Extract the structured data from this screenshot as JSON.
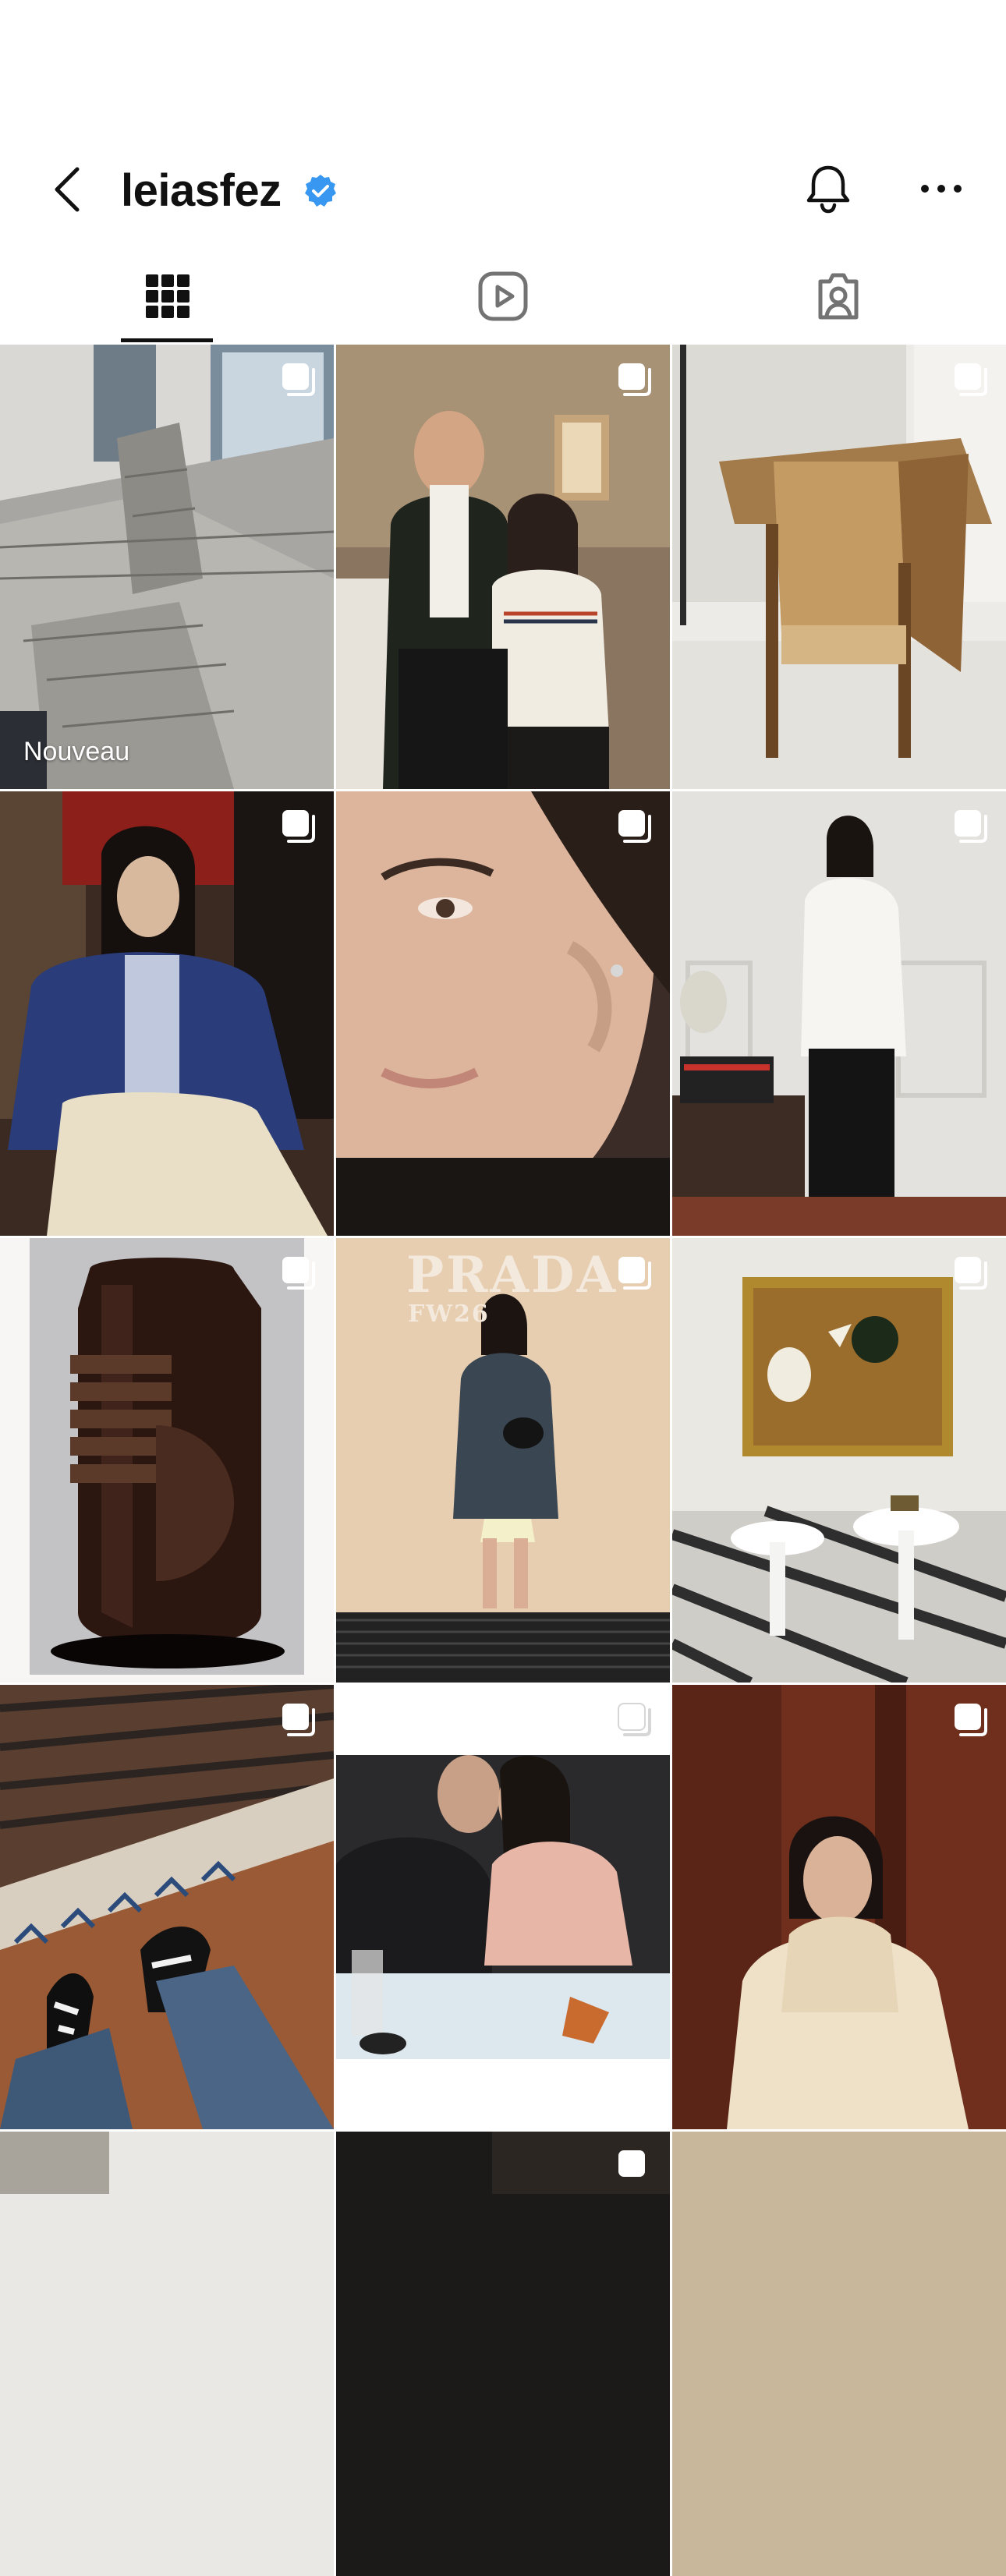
{
  "header": {
    "username": "leiasfez",
    "verified": true,
    "back_icon": "chevron-left-icon",
    "bell_icon": "bell-icon",
    "more_icon": "more-horizontal-icon"
  },
  "tabs": [
    {
      "name": "posts",
      "icon": "grid-icon",
      "selected": true
    },
    {
      "name": "reels",
      "icon": "reels-icon",
      "selected": false
    },
    {
      "name": "tagged",
      "icon": "tagged-icon",
      "selected": false
    }
  ],
  "grid": {
    "posts": [
      {
        "badge": "Nouveau",
        "multi": true
      },
      {
        "multi": true
      },
      {
        "multi": true
      },
      {
        "multi": true
      },
      {
        "multi": true
      },
      {
        "multi": true
      },
      {
        "multi": true
      },
      {
        "multi": true,
        "overlay_title": "PRADA",
        "overlay_subtitle": "FW26"
      },
      {
        "multi": true
      },
      {
        "multi": true
      },
      {
        "multi": true
      },
      {
        "multi": true
      }
    ]
  },
  "colors": {
    "verified_blue": "#3897f0",
    "text": "#111111",
    "icon_gray": "#737373"
  }
}
